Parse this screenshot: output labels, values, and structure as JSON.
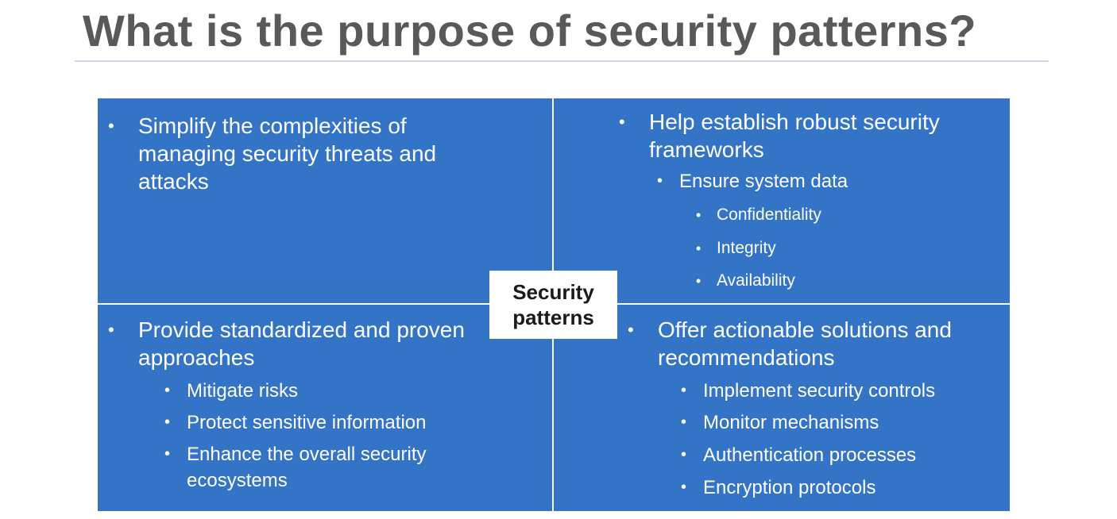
{
  "slide": {
    "title": "What is the purpose of security patterns?"
  },
  "center": {
    "line1": "Security",
    "line2": "patterns"
  },
  "quadrants": {
    "top_left": {
      "lines": [
        "Simplify the complexities of",
        "managing security threats and",
        "attacks"
      ]
    },
    "top_right": {
      "lines": [
        "Help establish robust security",
        "frameworks"
      ],
      "sub": "Ensure system data",
      "subsub": [
        "Confidentiality",
        "Integrity",
        "Availability"
      ]
    },
    "bottom_left": {
      "lines": [
        "Provide standardized and proven",
        "approaches"
      ],
      "sub": [
        "Mitigate risks",
        "Protect sensitive information",
        "Enhance the overall security",
        "ecosystems"
      ]
    },
    "bottom_right": {
      "lines": [
        "Offer actionable solutions and",
        "recommendations"
      ],
      "sub": [
        "Implement security controls",
        "Monitor mechanisms",
        "Authentication processes",
        "Encryption protocols"
      ]
    }
  },
  "bullet_glyph": "•"
}
